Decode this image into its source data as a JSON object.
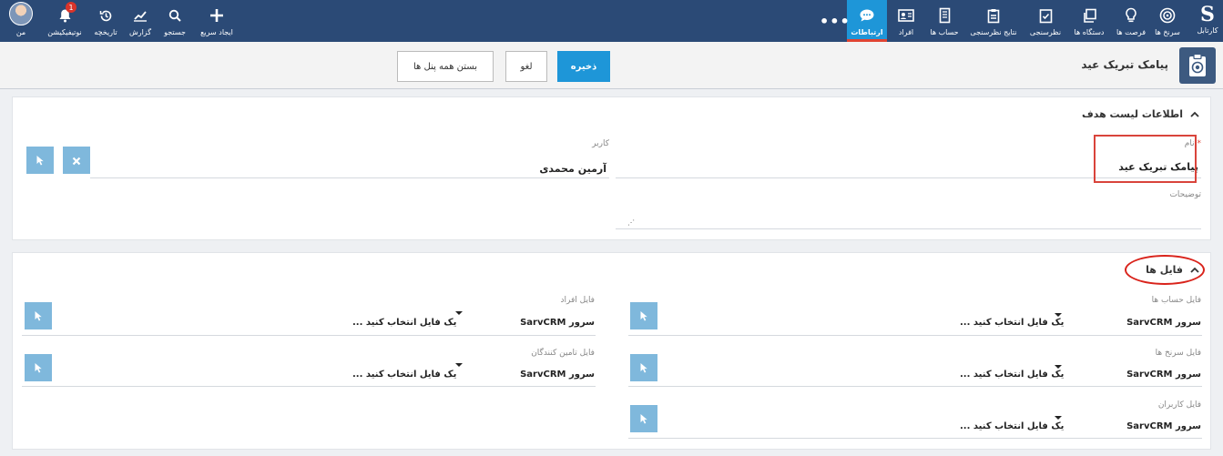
{
  "nav": {
    "logo_letter": "S",
    "logo_label": "کارتابل",
    "items": [
      {
        "label": "سرنخ ها",
        "icon": "target-icon"
      },
      {
        "label": "فرصت ها",
        "icon": "lightbulb-icon"
      },
      {
        "label": "دستگاه ها",
        "icon": "copy-icon"
      },
      {
        "label": "نظرسنجی",
        "icon": "checklist-icon"
      },
      {
        "label": "نتایج نظرسنجی",
        "icon": "clipboard-icon"
      },
      {
        "label": "حساب ها",
        "icon": "building-icon"
      },
      {
        "label": "افراد",
        "icon": "contact-card-icon"
      },
      {
        "label": "ارتباطات",
        "icon": "chat-bubble-icon"
      }
    ],
    "more": "•••",
    "right_tools": [
      {
        "label": "ایجاد سریع",
        "icon": "plus-icon"
      },
      {
        "label": "جستجو",
        "icon": "search-icon"
      },
      {
        "label": "گزارش",
        "icon": "chart-icon"
      },
      {
        "label": "تاریخچه",
        "icon": "history-icon"
      },
      {
        "label": "نوتیفیکیشن",
        "icon": "bell-icon"
      },
      {
        "label": "من",
        "icon": "avatar"
      }
    ],
    "notification_count": "1"
  },
  "page": {
    "title": "پیامک تبریک عید",
    "save_label": "ذخیره",
    "cancel_label": "لغو",
    "close_all_label": "بستن همه پنل ها"
  },
  "panel_target": {
    "title": "اطلاعات لیست هدف",
    "name_label": "نام",
    "name_required": "*",
    "name_value": "پیامک تبریک عید",
    "description_label": "توضیحات",
    "user_label": "کاربر",
    "user_value": "آرمین محمدی"
  },
  "panel_files": {
    "title": "فایل ها",
    "placeholder": "یک فایل انتخاب کنید ...",
    "server": "سرور SarvCRM",
    "fields": [
      {
        "label": "فایل حساب ها"
      },
      {
        "label": "فایل افراد"
      },
      {
        "label": "فایل سرنخ ها"
      },
      {
        "label": "فایل تامین کنندگان"
      },
      {
        "label": "فایل کاربران"
      }
    ]
  }
}
